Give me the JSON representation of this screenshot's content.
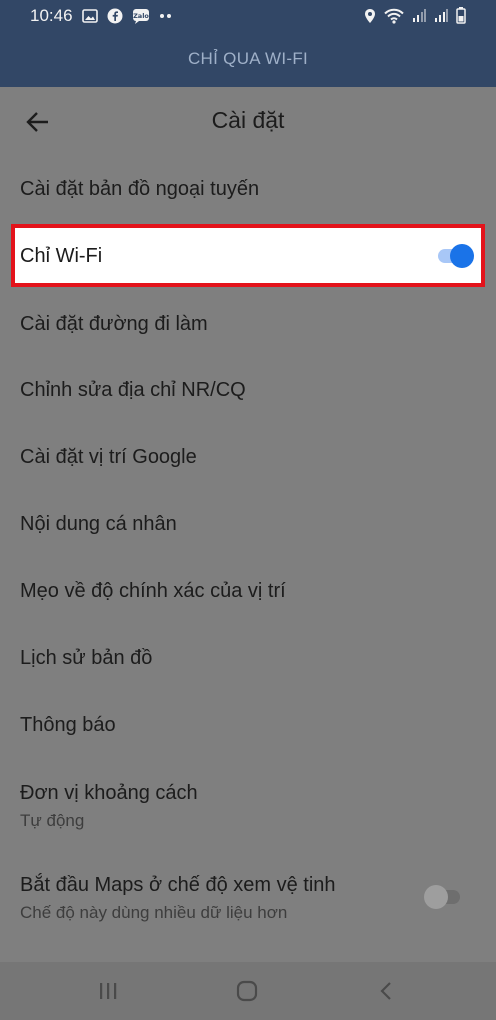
{
  "status_bar": {
    "time": "10:46",
    "left_icons": [
      "gallery-icon",
      "facebook-icon",
      "zalo-icon",
      "more-dots-icon"
    ],
    "right_icons": [
      "location-icon",
      "wifi-icon",
      "signal-icon",
      "signal-icon",
      "battery-icon"
    ]
  },
  "banner": {
    "text": "CHỈ QUA WI-FI"
  },
  "header": {
    "title": "Cài đặt"
  },
  "settings": {
    "offline_maps": "Cài đặt bản đồ ngoại tuyến",
    "wifi_only": {
      "label": "Chỉ Wi-Fi",
      "enabled": true
    },
    "commute": "Cài đặt đường đi làm",
    "edit_home_work": "Chỉnh sửa địa chỉ NR/CQ",
    "google_location": "Cài đặt vị trí Google",
    "personal_content": "Nội dung cá nhân",
    "location_accuracy": "Mẹo về độ chính xác của vị trí",
    "maps_history": "Lịch sử bản đồ",
    "notifications": "Thông báo",
    "distance_units": {
      "label": "Đơn vị khoảng cách",
      "value": "Tự động"
    },
    "satellite_view": {
      "label": "Bắt đầu Maps ở chế độ xem vệ tinh",
      "subtitle": "Chế độ này dùng nhiều dữ liệu hơn",
      "enabled": false
    }
  },
  "colors": {
    "status_bar_bg": "#324766",
    "overlay_bg": "#7f7f7f",
    "highlight_border": "#e3131b",
    "toggle_on_thumb": "#1a73e8",
    "toggle_on_track": "#a8c7f7",
    "toggle_off_thumb": "#9e9e9e",
    "toggle_off_track": "#6e6e6e"
  },
  "nav_bar": {
    "icons": [
      "recent-apps-icon",
      "home-icon",
      "back-icon"
    ]
  }
}
